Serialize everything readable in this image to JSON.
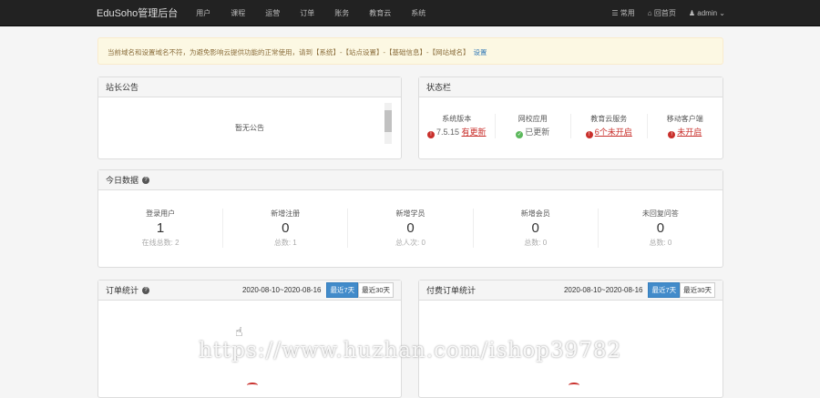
{
  "nav": {
    "brand": "EduSoho管理后台",
    "items": [
      "用户",
      "课程",
      "运营",
      "订单",
      "账务",
      "教育云",
      "系统"
    ],
    "common": "常用",
    "home": "回首页",
    "user": "admin"
  },
  "alert": {
    "text": "当前域名和设置域名不符，为避免影响云提供功能的正常使用，请到【系统】-【站点设置】-【基础信息】-【网站域名】",
    "link": "设置"
  },
  "notice": {
    "title": "站长公告",
    "empty": "暂无公告"
  },
  "status": {
    "title": "状态栏",
    "items": [
      {
        "label": "系统版本",
        "prefix": "7.5.15",
        "link": "有更新",
        "state": "warn"
      },
      {
        "label": "网校应用",
        "prefix": "",
        "text": "已更新",
        "state": "ok"
      },
      {
        "label": "教育云服务",
        "prefix": "",
        "link": "6个未开启",
        "state": "warn"
      },
      {
        "label": "移动客户端",
        "prefix": "",
        "link": "未开启",
        "state": "warn"
      }
    ]
  },
  "today": {
    "title": "今日数据",
    "items": [
      {
        "label": "登录用户",
        "value": "1",
        "sub": "在线总数: 2"
      },
      {
        "label": "新增注册",
        "value": "0",
        "sub": "总数: 1"
      },
      {
        "label": "新增学员",
        "value": "0",
        "sub": "总人次: 0"
      },
      {
        "label": "新增会员",
        "value": "0",
        "sub": "总数: 0"
      },
      {
        "label": "未回复问答",
        "value": "0",
        "sub": "总数: 0"
      }
    ]
  },
  "orders": {
    "title": "订单统计",
    "range": "2020-08-10~2020-08-16",
    "btn7": "最近7天",
    "btn30": "最近30天"
  },
  "paid": {
    "title": "付费订单统计",
    "range": "2020-08-10~2020-08-16",
    "btn7": "最近7天",
    "btn30": "最近30天"
  },
  "watermark": "https://www.huzhan.com/ishop39782"
}
